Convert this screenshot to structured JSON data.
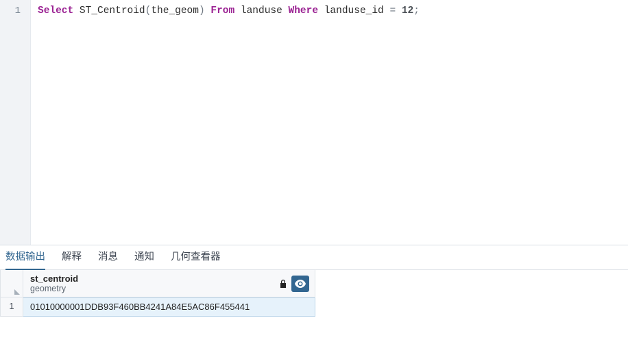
{
  "editor": {
    "line_number": "1",
    "sql": {
      "kw_select": "Select",
      "func": "ST_Centroid",
      "lp": "(",
      "arg": "the_geom",
      "rp": ")",
      "kw_from": "From",
      "table": "landuse",
      "kw_where": "Where",
      "col": "landuse_id",
      "eq": " = ",
      "val": "12",
      "semi": ";"
    }
  },
  "tabs": {
    "data_output": "数据输出",
    "explain": "解释",
    "messages": "消息",
    "notifications": "通知",
    "geometry_viewer": "几何查看器",
    "active": "data_output"
  },
  "result": {
    "column": {
      "name": "st_centroid",
      "type": "geometry"
    },
    "rows": [
      {
        "n": "1",
        "value": "01010000001DDB93F460BB4241A84E5AC86F455441"
      }
    ]
  }
}
